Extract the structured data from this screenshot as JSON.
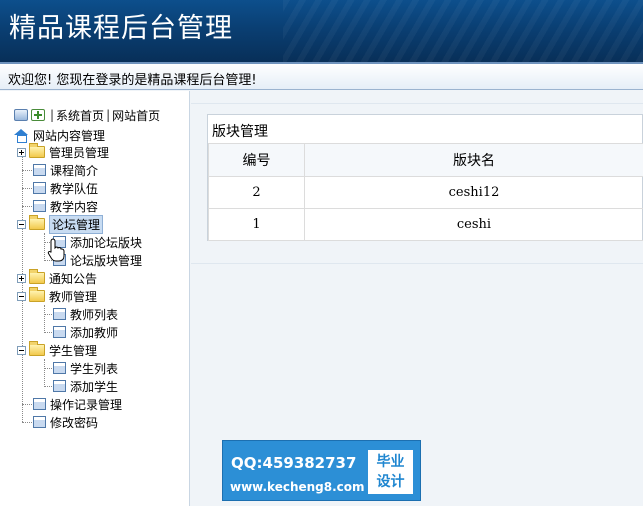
{
  "header": {
    "title": "精品课程后台管理"
  },
  "welcome": {
    "text": "欢迎您! 您现在登录的是精品课程后台管理!"
  },
  "sidebar": {
    "top_links": {
      "sep1": "|",
      "system_home": "系统首页",
      "sep2": "|",
      "site_home": "网站首页"
    },
    "root_label": "网站内容管理",
    "items": [
      {
        "label": "管理员管理",
        "type": "folder",
        "expanded": false
      },
      {
        "label": "课程简介",
        "type": "page"
      },
      {
        "label": "教学队伍",
        "type": "page"
      },
      {
        "label": "教学内容",
        "type": "page"
      },
      {
        "label": "论坛管理",
        "type": "folder",
        "expanded": true,
        "selected": true,
        "children": [
          {
            "label": "添加论坛版块"
          },
          {
            "label": "论坛版块管理"
          }
        ]
      },
      {
        "label": "通知公告",
        "type": "folder",
        "expanded": false
      },
      {
        "label": "教师管理",
        "type": "folder",
        "expanded": true,
        "children": [
          {
            "label": "教师列表"
          },
          {
            "label": "添加教师"
          }
        ]
      },
      {
        "label": "学生管理",
        "type": "folder",
        "expanded": true,
        "children": [
          {
            "label": "学生列表"
          },
          {
            "label": "添加学生"
          }
        ]
      },
      {
        "label": "操作记录管理",
        "type": "page"
      },
      {
        "label": "修改密码",
        "type": "page"
      }
    ]
  },
  "panel": {
    "title": "版块管理",
    "columns": [
      "编号",
      "版块名"
    ],
    "rows": [
      {
        "id": "2",
        "name": "ceshi12"
      },
      {
        "id": "1",
        "name": "ceshi"
      }
    ]
  },
  "watermark": {
    "qq": "QQ:459382737",
    "url": "www.kecheng8.com",
    "badge_line1": "毕业",
    "badge_line2": "设计"
  },
  "colors": {
    "header_bg": "#0a3f73",
    "selected_bg": "#c8dcf2",
    "watermark_bg": "#2c8fd6"
  }
}
